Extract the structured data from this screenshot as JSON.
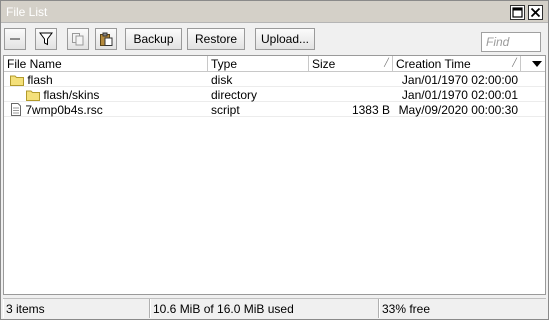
{
  "window": {
    "title": "File List"
  },
  "toolbar": {
    "backup_label": "Backup",
    "restore_label": "Restore",
    "upload_label": "Upload...",
    "find_placeholder": "Find"
  },
  "table": {
    "columns": [
      "File Name",
      "Type",
      "Size",
      "Creation Time"
    ],
    "rows": [
      {
        "name": "flash",
        "type": "disk",
        "size": "",
        "created": "Jan/01/1970 02:00:00",
        "icon": "folder-icon"
      },
      {
        "name": "flash/skins",
        "type": "directory",
        "size": "",
        "created": "Jan/01/1970 02:00:01",
        "icon": "folder-icon"
      },
      {
        "name": "7wmp0b4s.rsc",
        "type": "script",
        "size": "1383 B",
        "created": "May/09/2020 00:00:30",
        "icon": "document-icon"
      }
    ]
  },
  "status": {
    "items": "3 items",
    "usage": "10.6 MiB of 16.0 MiB used",
    "free": "33% free"
  },
  "colors": {
    "folder": "#f4e07a",
    "folder_edge": "#b29a2c",
    "titlebar": "#d4d0c8"
  }
}
